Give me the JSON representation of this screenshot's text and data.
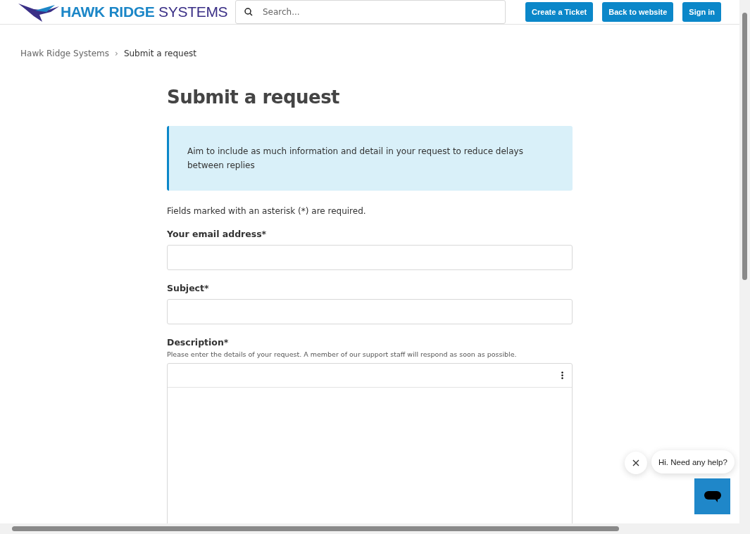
{
  "header": {
    "logo": {
      "primary": "HAWK RIDGE",
      "secondary": "SYSTEMS"
    },
    "search": {
      "placeholder": "Search..."
    },
    "buttons": [
      "Create a Ticket",
      "Back to website",
      "Sign in"
    ]
  },
  "breadcrumbs": [
    {
      "label": "Hawk Ridge Systems",
      "current": false
    },
    {
      "label": "Submit a request",
      "current": true
    }
  ],
  "separator": "›",
  "title": "Submit a request",
  "notice": "Aim to include as much information and detail in your request to reduce delays between replies",
  "required_note": "Fields marked with an asterisk (*) are required.",
  "fields": [
    {
      "label": "Your email address*",
      "kind": "input"
    },
    {
      "label": "Subject*",
      "kind": "input"
    },
    {
      "label": "Description*",
      "kind": "editor",
      "hint": "Please enter the details of your request. A member of our support staff will respond as soon as possible."
    }
  ],
  "chat": {
    "message": "Hi. Need any help?"
  }
}
